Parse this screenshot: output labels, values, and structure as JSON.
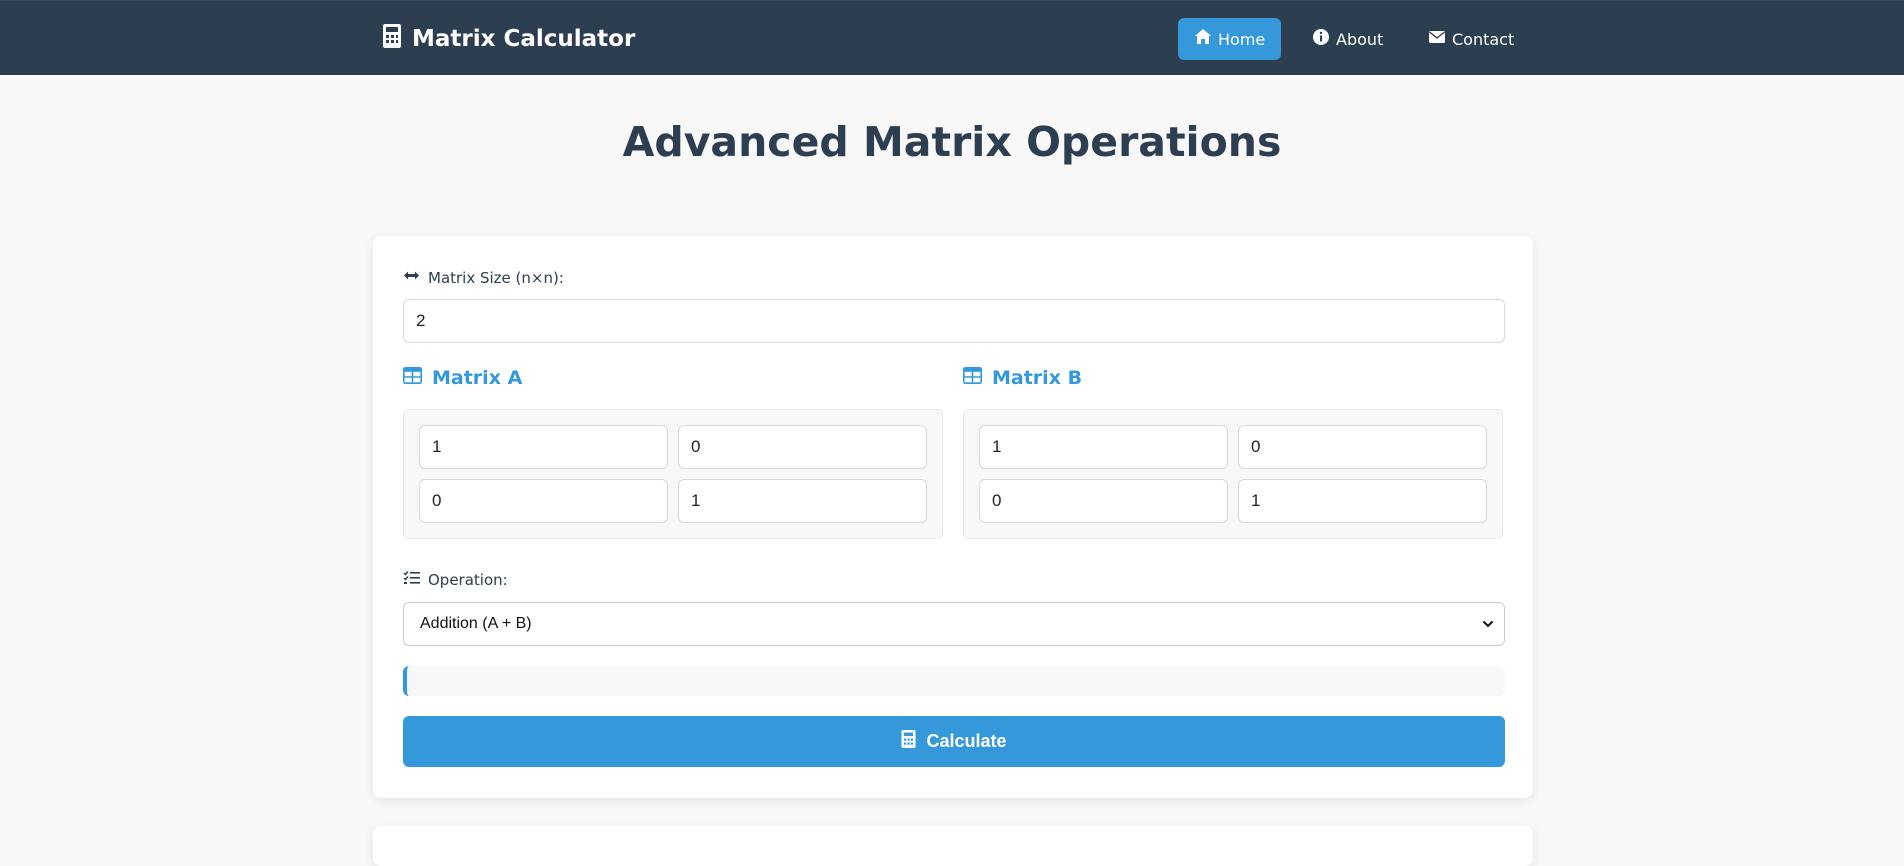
{
  "nav": {
    "brand": "Matrix Calculator",
    "brand_icon": "calculator-icon",
    "links": [
      {
        "label": "Home",
        "icon": "home-icon",
        "active": true
      },
      {
        "label": "About",
        "icon": "info-icon",
        "active": false
      },
      {
        "label": "Contact",
        "icon": "envelope-icon",
        "active": false
      }
    ]
  },
  "page": {
    "title": "Advanced Matrix Operations"
  },
  "form": {
    "size_label": "Matrix Size (n×n):",
    "size_value": "2",
    "matrix_a": {
      "title": "Matrix A",
      "cells": [
        "1",
        "0",
        "0",
        "1"
      ]
    },
    "matrix_b": {
      "title": "Matrix B",
      "cells": [
        "1",
        "0",
        "0",
        "1"
      ]
    },
    "operation_label": "Operation:",
    "operation_selected": "Addition (A + B)",
    "calculate_label": "Calculate"
  },
  "colors": {
    "navbar": "#2c3e50",
    "accent": "#3498db",
    "background": "#f8f8f8",
    "title": "#2c3e50"
  }
}
